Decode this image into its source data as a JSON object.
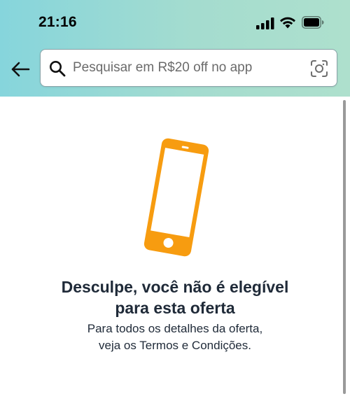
{
  "status_bar": {
    "time": "21:16",
    "icons": [
      "signal-icon",
      "wifi-icon",
      "battery-icon"
    ]
  },
  "header": {
    "back_icon": "arrow-left-icon",
    "search": {
      "placeholder": "Pesquisar em R$20 off no app",
      "value": "",
      "search_icon": "magnifier-icon",
      "camera_icon": "camera-scan-icon"
    }
  },
  "colors": {
    "header_gradient_start": "#86d5dc",
    "header_gradient_end": "#aee0cd",
    "illustration": "#f79c10",
    "text_dark": "#1f2a38"
  },
  "message": {
    "illustration_icon": "smartphone-icon",
    "title_line1": "Desculpe, você não é elegível",
    "title_line2": "para esta oferta",
    "detail_line1": "Para todos os detalhes da oferta,",
    "detail_line2": "veja os Termos e Condições."
  }
}
